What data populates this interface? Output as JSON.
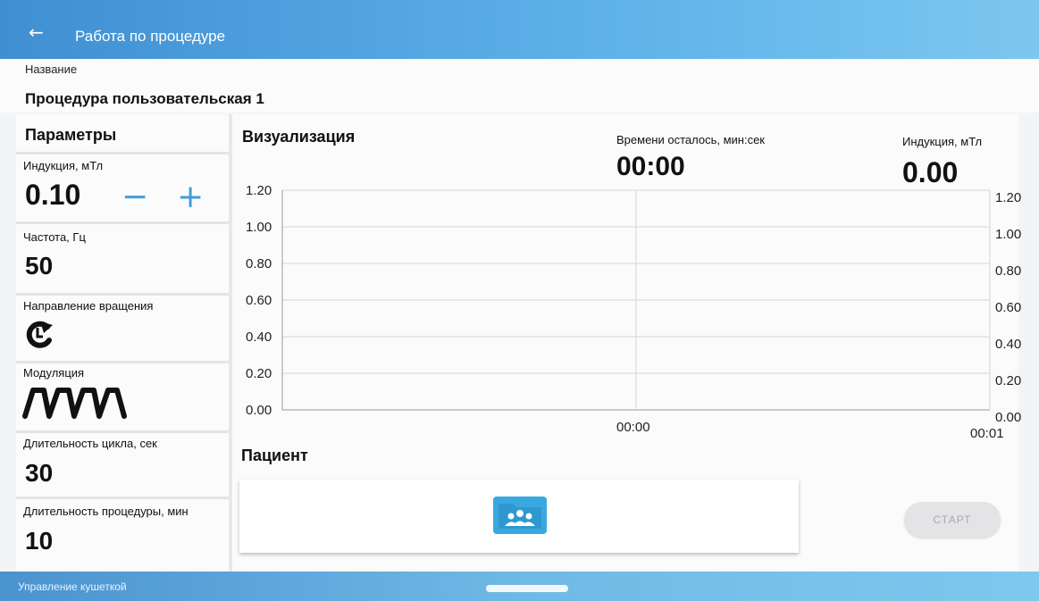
{
  "header": {
    "title": "Работа по процедуре",
    "back_icon": "arrow-back-icon"
  },
  "procedure": {
    "name_label": "Название",
    "name_value": "Процедура пользовательская 1"
  },
  "params": {
    "title": "Параметры",
    "induction": {
      "label": "Индукция, мТл",
      "value": "0.10",
      "minus": "−",
      "plus": "+"
    },
    "frequency": {
      "label": "Частота, Гц",
      "value": "50"
    },
    "rotation": {
      "label": "Направление вращения",
      "icon": "rotate-ccw-icon"
    },
    "modulation": {
      "label": "Модуляция",
      "icon": "square-wave-icon"
    },
    "cycle": {
      "label": "Длительность цикла, сек",
      "value": "30"
    },
    "duration": {
      "label": "Длительность процедуры, мин",
      "value": "10"
    }
  },
  "visualization": {
    "title": "Визуализация",
    "time_left_label": "Времени осталось, мин:сек",
    "time_left_value": "00:00",
    "induction_label": "Индукция, мТл",
    "induction_value": "0.00"
  },
  "chart_data": {
    "type": "line",
    "series": [],
    "y_ticks_left": [
      "1.20",
      "1.00",
      "0.80",
      "0.60",
      "0.40",
      "0.20",
      "0.00"
    ],
    "y_ticks_right": [
      "1.20",
      "1.00",
      "0.80",
      "0.60",
      "0.40",
      "0.20",
      "0.00"
    ],
    "x_ticks": [
      "00:00",
      "00:01"
    ],
    "ylim": [
      0,
      1.2
    ],
    "grid": true
  },
  "patient": {
    "title": "Пациент",
    "icon": "patients-folder-icon"
  },
  "actions": {
    "start_label": "СТАРТ"
  },
  "footer": {
    "label": "Управление кушеткой"
  },
  "colors": {
    "accent": "#3f9ed8",
    "header": "#4a9fe0",
    "folder": "#3aa8e0"
  }
}
